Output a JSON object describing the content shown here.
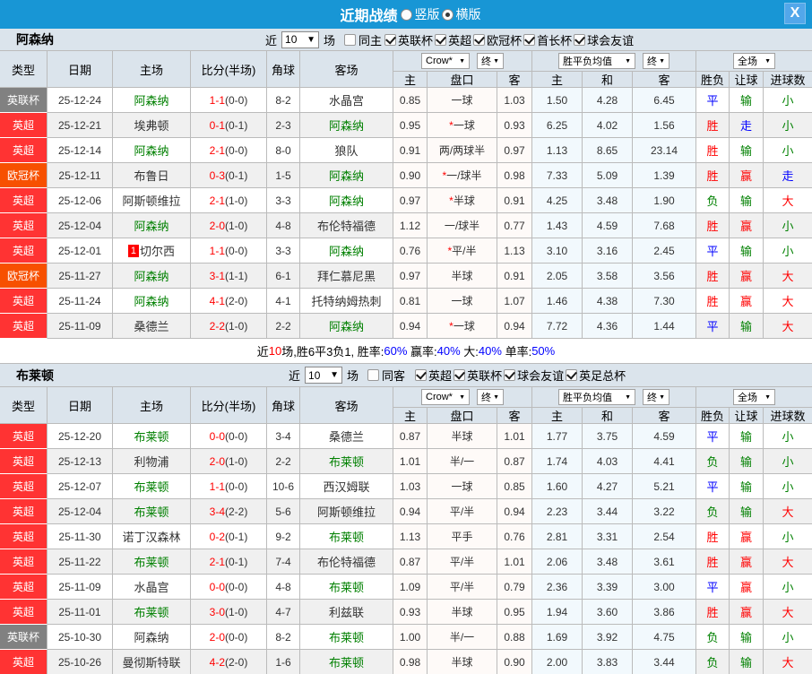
{
  "titlebar": {
    "title": "近期战绩",
    "radios": [
      {
        "label": "竖版",
        "selected": false
      },
      {
        "label": "横版",
        "selected": true
      }
    ],
    "close_label": "X"
  },
  "table_columns": {
    "type": "类型",
    "date": "日期",
    "home": "主场",
    "score": "比分(半场)",
    "corners": "角球",
    "away": "客场",
    "odds_source": "Crow*",
    "odds_final": "终",
    "avg_label": "胜平负均值",
    "avg_final": "终",
    "scope": "全场",
    "odds_home": "主",
    "handicap": "盘口",
    "odds_away": "客",
    "avg_home": "主",
    "avg_draw": "和",
    "avg_away": "客",
    "wdl": "胜负",
    "handicap_result": "让球",
    "goals": "进球数"
  },
  "league_colors": {
    "英超": "#ff3333",
    "英联杯": "#818181",
    "欧冠杯": "#f75000"
  },
  "result_colors": {
    "胜": "#ff0000",
    "负": "#008000",
    "平": "#0000ff",
    "赢": "#ff0000",
    "输": "#008000",
    "走": "#0000ff",
    "大": "#ff0000",
    "小": "#008000"
  },
  "accent_colors": {
    "team_active": "#008000",
    "score": "#ff0000",
    "text": "#333333",
    "titlebar": "#1896d5",
    "header_bg": "#dbe4ec",
    "border": "#bbbbbb",
    "odds_bg": "#fefaf8",
    "avg_bg": "#f2f9fd",
    "row_alt": "#f0f0f0",
    "badge": "#ff0000"
  },
  "sections": [
    {
      "team": "阿森纳",
      "filters": {
        "prefix": "近",
        "count": "10",
        "suffix": "场",
        "same_label": "同主",
        "same_checked": false,
        "leagues": [
          {
            "label": "英联杯",
            "checked": true
          },
          {
            "label": "英超",
            "checked": true
          },
          {
            "label": "欧冠杯",
            "checked": true
          },
          {
            "label": "首长杯",
            "checked": true
          },
          {
            "label": "球会友谊",
            "checked": true
          }
        ]
      },
      "rows": [
        {
          "league": "英联杯",
          "date": "25-12-24",
          "home": "阿森纳",
          "home_active": true,
          "home_badge": "",
          "score": "1-1",
          "half": "(0-0)",
          "corners": "8-2",
          "away": "水晶宫",
          "away_active": false,
          "odds": [
            "0.85",
            "一球",
            "1.03"
          ],
          "avg": [
            "1.50",
            "4.28",
            "6.45"
          ],
          "results": [
            "平",
            "输",
            "小"
          ]
        },
        {
          "league": "英超",
          "date": "25-12-21",
          "home": "埃弗顿",
          "home_active": false,
          "home_badge": "",
          "score": "0-1",
          "half": "(0-1)",
          "corners": "2-3",
          "away": "阿森纳",
          "away_active": true,
          "odds": [
            "0.95",
            "*一球",
            "0.93"
          ],
          "avg": [
            "6.25",
            "4.02",
            "1.56"
          ],
          "results": [
            "胜",
            "走",
            "小"
          ]
        },
        {
          "league": "英超",
          "date": "25-12-14",
          "home": "阿森纳",
          "home_active": true,
          "home_badge": "",
          "score": "2-1",
          "half": "(0-0)",
          "corners": "8-0",
          "away": "狼队",
          "away_active": false,
          "odds": [
            "0.91",
            "两/两球半",
            "0.97"
          ],
          "avg": [
            "1.13",
            "8.65",
            "23.14"
          ],
          "results": [
            "胜",
            "输",
            "小"
          ]
        },
        {
          "league": "欧冠杯",
          "date": "25-12-11",
          "home": "布鲁日",
          "home_active": false,
          "home_badge": "",
          "score": "0-3",
          "half": "(0-1)",
          "corners": "1-5",
          "away": "阿森纳",
          "away_active": true,
          "odds": [
            "0.90",
            "*一/球半",
            "0.98"
          ],
          "avg": [
            "7.33",
            "5.09",
            "1.39"
          ],
          "results": [
            "胜",
            "赢",
            "走"
          ]
        },
        {
          "league": "英超",
          "date": "25-12-06",
          "home": "阿斯顿维拉",
          "home_active": false,
          "home_badge": "",
          "score": "2-1",
          "half": "(1-0)",
          "corners": "3-3",
          "away": "阿森纳",
          "away_active": true,
          "odds": [
            "0.97",
            "*半球",
            "0.91"
          ],
          "avg": [
            "4.25",
            "3.48",
            "1.90"
          ],
          "results": [
            "负",
            "输",
            "大"
          ]
        },
        {
          "league": "英超",
          "date": "25-12-04",
          "home": "阿森纳",
          "home_active": true,
          "home_badge": "",
          "score": "2-0",
          "half": "(1-0)",
          "corners": "4-8",
          "away": "布伦特福德",
          "away_active": false,
          "odds": [
            "1.12",
            "一/球半",
            "0.77"
          ],
          "avg": [
            "1.43",
            "4.59",
            "7.68"
          ],
          "results": [
            "胜",
            "赢",
            "小"
          ]
        },
        {
          "league": "英超",
          "date": "25-12-01",
          "home": "切尔西",
          "home_active": false,
          "home_badge": "1",
          "score": "1-1",
          "half": "(0-0)",
          "corners": "3-3",
          "away": "阿森纳",
          "away_active": true,
          "odds": [
            "0.76",
            "*平/半",
            "1.13"
          ],
          "avg": [
            "3.10",
            "3.16",
            "2.45"
          ],
          "results": [
            "平",
            "输",
            "小"
          ]
        },
        {
          "league": "欧冠杯",
          "date": "25-11-27",
          "home": "阿森纳",
          "home_active": true,
          "home_badge": "",
          "score": "3-1",
          "half": "(1-1)",
          "corners": "6-1",
          "away": "拜仁慕尼黑",
          "away_active": false,
          "odds": [
            "0.97",
            "半球",
            "0.91"
          ],
          "avg": [
            "2.05",
            "3.58",
            "3.56"
          ],
          "results": [
            "胜",
            "赢",
            "大"
          ]
        },
        {
          "league": "英超",
          "date": "25-11-24",
          "home": "阿森纳",
          "home_active": true,
          "home_badge": "",
          "score": "4-1",
          "half": "(2-0)",
          "corners": "4-1",
          "away": "托特纳姆热刺",
          "away_active": false,
          "odds": [
            "0.81",
            "一球",
            "1.07"
          ],
          "avg": [
            "1.46",
            "4.38",
            "7.30"
          ],
          "results": [
            "胜",
            "赢",
            "大"
          ]
        },
        {
          "league": "英超",
          "date": "25-11-09",
          "home": "桑德兰",
          "home_active": false,
          "home_badge": "",
          "score": "2-2",
          "half": "(1-0)",
          "corners": "2-2",
          "away": "阿森纳",
          "away_active": true,
          "odds": [
            "0.94",
            "*一球",
            "0.94"
          ],
          "avg": [
            "7.72",
            "4.36",
            "1.44"
          ],
          "results": [
            "平",
            "输",
            "大"
          ]
        }
      ],
      "summary": [
        {
          "text": "近",
          "color": "black"
        },
        {
          "text": "10",
          "color": "red"
        },
        {
          "text": "场,胜6平3负1, 胜率:",
          "color": "black"
        },
        {
          "text": "60%",
          "color": "blue"
        },
        {
          "text": " 赢率:",
          "color": "black"
        },
        {
          "text": "40%",
          "color": "blue"
        },
        {
          "text": " 大:",
          "color": "black"
        },
        {
          "text": "40%",
          "color": "blue"
        },
        {
          "text": " 单率:",
          "color": "black"
        },
        {
          "text": "50%",
          "color": "blue"
        }
      ]
    },
    {
      "team": "布莱顿",
      "filters": {
        "prefix": "近",
        "count": "10",
        "suffix": "场",
        "same_label": "同客",
        "same_checked": false,
        "leagues": [
          {
            "label": "英超",
            "checked": true
          },
          {
            "label": "英联杯",
            "checked": true
          },
          {
            "label": "球会友谊",
            "checked": true
          },
          {
            "label": "英足总杯",
            "checked": true
          }
        ]
      },
      "rows": [
        {
          "league": "英超",
          "date": "25-12-20",
          "home": "布莱顿",
          "home_active": true,
          "home_badge": "",
          "score": "0-0",
          "half": "(0-0)",
          "corners": "3-4",
          "away": "桑德兰",
          "away_active": false,
          "odds": [
            "0.87",
            "半球",
            "1.01"
          ],
          "avg": [
            "1.77",
            "3.75",
            "4.59"
          ],
          "results": [
            "平",
            "输",
            "小"
          ]
        },
        {
          "league": "英超",
          "date": "25-12-13",
          "home": "利物浦",
          "home_active": false,
          "home_badge": "",
          "score": "2-0",
          "half": "(1-0)",
          "corners": "2-2",
          "away": "布莱顿",
          "away_active": true,
          "odds": [
            "1.01",
            "半/一",
            "0.87"
          ],
          "avg": [
            "1.74",
            "4.03",
            "4.41"
          ],
          "results": [
            "负",
            "输",
            "小"
          ]
        },
        {
          "league": "英超",
          "date": "25-12-07",
          "home": "布莱顿",
          "home_active": true,
          "home_badge": "",
          "score": "1-1",
          "half": "(0-0)",
          "corners": "10-6",
          "away": "西汉姆联",
          "away_active": false,
          "odds": [
            "1.03",
            "一球",
            "0.85"
          ],
          "avg": [
            "1.60",
            "4.27",
            "5.21"
          ],
          "results": [
            "平",
            "输",
            "小"
          ]
        },
        {
          "league": "英超",
          "date": "25-12-04",
          "home": "布莱顿",
          "home_active": true,
          "home_badge": "",
          "score": "3-4",
          "half": "(2-2)",
          "corners": "5-6",
          "away": "阿斯顿维拉",
          "away_active": false,
          "odds": [
            "0.94",
            "平/半",
            "0.94"
          ],
          "avg": [
            "2.23",
            "3.44",
            "3.22"
          ],
          "results": [
            "负",
            "输",
            "大"
          ]
        },
        {
          "league": "英超",
          "date": "25-11-30",
          "home": "诺丁汉森林",
          "home_active": false,
          "home_badge": "",
          "score": "0-2",
          "half": "(0-1)",
          "corners": "9-2",
          "away": "布莱顿",
          "away_active": true,
          "odds": [
            "1.13",
            "平手",
            "0.76"
          ],
          "avg": [
            "2.81",
            "3.31",
            "2.54"
          ],
          "results": [
            "胜",
            "赢",
            "小"
          ]
        },
        {
          "league": "英超",
          "date": "25-11-22",
          "home": "布莱顿",
          "home_active": true,
          "home_badge": "",
          "score": "2-1",
          "half": "(0-1)",
          "corners": "7-4",
          "away": "布伦特福德",
          "away_active": false,
          "odds": [
            "0.87",
            "平/半",
            "1.01"
          ],
          "avg": [
            "2.06",
            "3.48",
            "3.61"
          ],
          "results": [
            "胜",
            "赢",
            "大"
          ]
        },
        {
          "league": "英超",
          "date": "25-11-09",
          "home": "水晶宫",
          "home_active": false,
          "home_badge": "",
          "score": "0-0",
          "half": "(0-0)",
          "corners": "4-8",
          "away": "布莱顿",
          "away_active": true,
          "odds": [
            "1.09",
            "平/半",
            "0.79"
          ],
          "avg": [
            "2.36",
            "3.39",
            "3.00"
          ],
          "results": [
            "平",
            "赢",
            "小"
          ]
        },
        {
          "league": "英超",
          "date": "25-11-01",
          "home": "布莱顿",
          "home_active": true,
          "home_badge": "",
          "score": "3-0",
          "half": "(1-0)",
          "corners": "4-7",
          "away": "利兹联",
          "away_active": false,
          "odds": [
            "0.93",
            "半球",
            "0.95"
          ],
          "avg": [
            "1.94",
            "3.60",
            "3.86"
          ],
          "results": [
            "胜",
            "赢",
            "大"
          ]
        },
        {
          "league": "英联杯",
          "date": "25-10-30",
          "home": "阿森纳",
          "home_active": false,
          "home_badge": "",
          "score": "2-0",
          "half": "(0-0)",
          "corners": "8-2",
          "away": "布莱顿",
          "away_active": true,
          "odds": [
            "1.00",
            "半/一",
            "0.88"
          ],
          "avg": [
            "1.69",
            "3.92",
            "4.75"
          ],
          "results": [
            "负",
            "输",
            "小"
          ]
        },
        {
          "league": "英超",
          "date": "25-10-26",
          "home": "曼彻斯特联",
          "home_active": false,
          "home_badge": "",
          "score": "4-2",
          "half": "(2-0)",
          "corners": "1-6",
          "away": "布莱顿",
          "away_active": true,
          "odds": [
            "0.98",
            "半球",
            "0.90"
          ],
          "avg": [
            "2.00",
            "3.83",
            "3.44"
          ],
          "results": [
            "负",
            "输",
            "大"
          ]
        }
      ],
      "summary": null
    }
  ]
}
